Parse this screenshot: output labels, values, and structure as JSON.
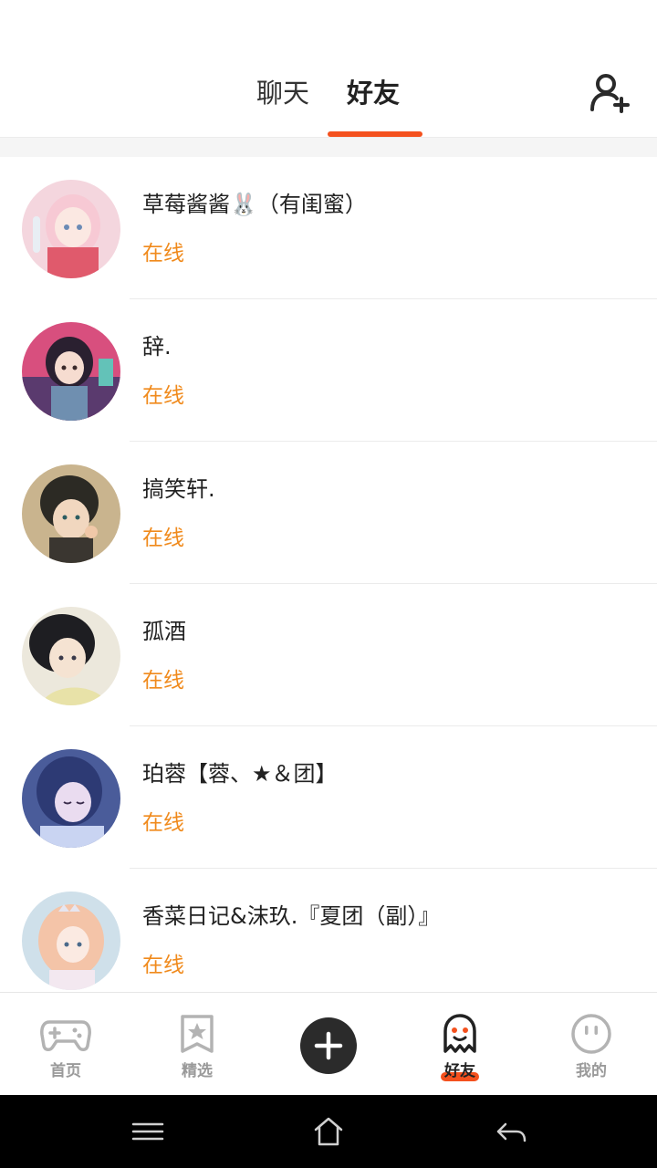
{
  "header": {
    "tabs": [
      {
        "label": "聊天",
        "active": false
      },
      {
        "label": "好友",
        "active": true
      }
    ],
    "accent_color": "#f4511e",
    "add_friend_icon": "add-user-icon"
  },
  "friends": [
    {
      "name": "草莓酱酱🐰（有闺蜜）",
      "status": "在线"
    },
    {
      "name": "辞.",
      "status": "在线"
    },
    {
      "name": "搞笑轩.",
      "status": "在线"
    },
    {
      "name": "孤酒",
      "status": "在线"
    },
    {
      "name": "珀蓉【蓉、★＆团】",
      "status": "在线"
    },
    {
      "name": "香菜日记&沫玖.『夏团（副）』",
      "status": "在线"
    }
  ],
  "status_color": "#f08a1c",
  "bottom_nav": {
    "items": [
      {
        "label": "首页",
        "icon": "gamepad-icon"
      },
      {
        "label": "精选",
        "icon": "star-bookmark-icon"
      },
      {
        "label": "",
        "icon": "plus-icon"
      },
      {
        "label": "好友",
        "icon": "ghost-icon",
        "active": true
      },
      {
        "label": "我的",
        "icon": "face-icon"
      }
    ]
  },
  "system_bar": {
    "buttons": [
      "menu-icon",
      "home-icon",
      "back-icon"
    ]
  }
}
